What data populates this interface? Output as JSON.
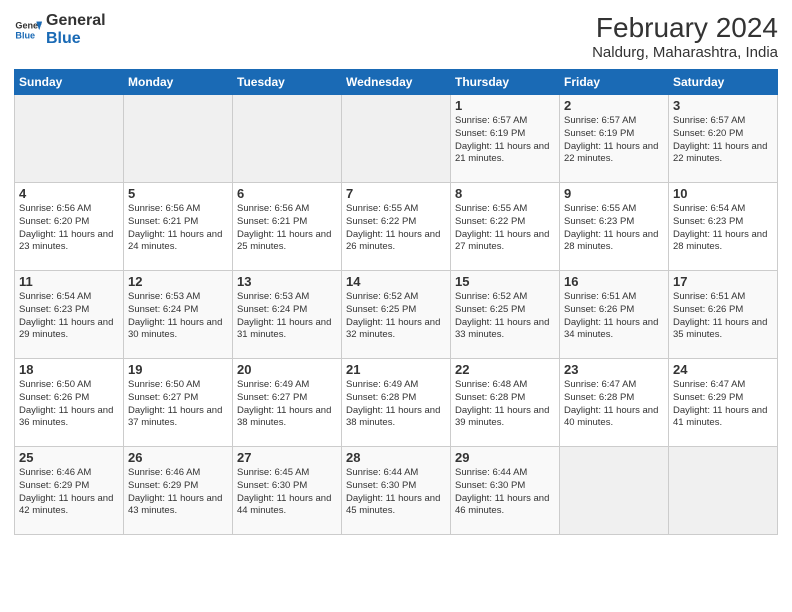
{
  "header": {
    "logo_line1": "General",
    "logo_line2": "Blue",
    "title": "February 2024",
    "subtitle": "Naldurg, Maharashtra, India"
  },
  "days_of_week": [
    "Sunday",
    "Monday",
    "Tuesday",
    "Wednesday",
    "Thursday",
    "Friday",
    "Saturday"
  ],
  "weeks": [
    [
      {
        "day": "",
        "info": ""
      },
      {
        "day": "",
        "info": ""
      },
      {
        "day": "",
        "info": ""
      },
      {
        "day": "",
        "info": ""
      },
      {
        "day": "1",
        "info": "Sunrise: 6:57 AM\nSunset: 6:19 PM\nDaylight: 11 hours\nand 21 minutes."
      },
      {
        "day": "2",
        "info": "Sunrise: 6:57 AM\nSunset: 6:19 PM\nDaylight: 11 hours\nand 22 minutes."
      },
      {
        "day": "3",
        "info": "Sunrise: 6:57 AM\nSunset: 6:20 PM\nDaylight: 11 hours\nand 22 minutes."
      }
    ],
    [
      {
        "day": "4",
        "info": "Sunrise: 6:56 AM\nSunset: 6:20 PM\nDaylight: 11 hours\nand 23 minutes."
      },
      {
        "day": "5",
        "info": "Sunrise: 6:56 AM\nSunset: 6:21 PM\nDaylight: 11 hours\nand 24 minutes."
      },
      {
        "day": "6",
        "info": "Sunrise: 6:56 AM\nSunset: 6:21 PM\nDaylight: 11 hours\nand 25 minutes."
      },
      {
        "day": "7",
        "info": "Sunrise: 6:55 AM\nSunset: 6:22 PM\nDaylight: 11 hours\nand 26 minutes."
      },
      {
        "day": "8",
        "info": "Sunrise: 6:55 AM\nSunset: 6:22 PM\nDaylight: 11 hours\nand 27 minutes."
      },
      {
        "day": "9",
        "info": "Sunrise: 6:55 AM\nSunset: 6:23 PM\nDaylight: 11 hours\nand 28 minutes."
      },
      {
        "day": "10",
        "info": "Sunrise: 6:54 AM\nSunset: 6:23 PM\nDaylight: 11 hours\nand 28 minutes."
      }
    ],
    [
      {
        "day": "11",
        "info": "Sunrise: 6:54 AM\nSunset: 6:23 PM\nDaylight: 11 hours\nand 29 minutes."
      },
      {
        "day": "12",
        "info": "Sunrise: 6:53 AM\nSunset: 6:24 PM\nDaylight: 11 hours\nand 30 minutes."
      },
      {
        "day": "13",
        "info": "Sunrise: 6:53 AM\nSunset: 6:24 PM\nDaylight: 11 hours\nand 31 minutes."
      },
      {
        "day": "14",
        "info": "Sunrise: 6:52 AM\nSunset: 6:25 PM\nDaylight: 11 hours\nand 32 minutes."
      },
      {
        "day": "15",
        "info": "Sunrise: 6:52 AM\nSunset: 6:25 PM\nDaylight: 11 hours\nand 33 minutes."
      },
      {
        "day": "16",
        "info": "Sunrise: 6:51 AM\nSunset: 6:26 PM\nDaylight: 11 hours\nand 34 minutes."
      },
      {
        "day": "17",
        "info": "Sunrise: 6:51 AM\nSunset: 6:26 PM\nDaylight: 11 hours\nand 35 minutes."
      }
    ],
    [
      {
        "day": "18",
        "info": "Sunrise: 6:50 AM\nSunset: 6:26 PM\nDaylight: 11 hours\nand 36 minutes."
      },
      {
        "day": "19",
        "info": "Sunrise: 6:50 AM\nSunset: 6:27 PM\nDaylight: 11 hours\nand 37 minutes."
      },
      {
        "day": "20",
        "info": "Sunrise: 6:49 AM\nSunset: 6:27 PM\nDaylight: 11 hours\nand 38 minutes."
      },
      {
        "day": "21",
        "info": "Sunrise: 6:49 AM\nSunset: 6:28 PM\nDaylight: 11 hours\nand 38 minutes."
      },
      {
        "day": "22",
        "info": "Sunrise: 6:48 AM\nSunset: 6:28 PM\nDaylight: 11 hours\nand 39 minutes."
      },
      {
        "day": "23",
        "info": "Sunrise: 6:47 AM\nSunset: 6:28 PM\nDaylight: 11 hours\nand 40 minutes."
      },
      {
        "day": "24",
        "info": "Sunrise: 6:47 AM\nSunset: 6:29 PM\nDaylight: 11 hours\nand 41 minutes."
      }
    ],
    [
      {
        "day": "25",
        "info": "Sunrise: 6:46 AM\nSunset: 6:29 PM\nDaylight: 11 hours\nand 42 minutes."
      },
      {
        "day": "26",
        "info": "Sunrise: 6:46 AM\nSunset: 6:29 PM\nDaylight: 11 hours\nand 43 minutes."
      },
      {
        "day": "27",
        "info": "Sunrise: 6:45 AM\nSunset: 6:30 PM\nDaylight: 11 hours\nand 44 minutes."
      },
      {
        "day": "28",
        "info": "Sunrise: 6:44 AM\nSunset: 6:30 PM\nDaylight: 11 hours\nand 45 minutes."
      },
      {
        "day": "29",
        "info": "Sunrise: 6:44 AM\nSunset: 6:30 PM\nDaylight: 11 hours\nand 46 minutes."
      },
      {
        "day": "",
        "info": ""
      },
      {
        "day": "",
        "info": ""
      }
    ]
  ]
}
